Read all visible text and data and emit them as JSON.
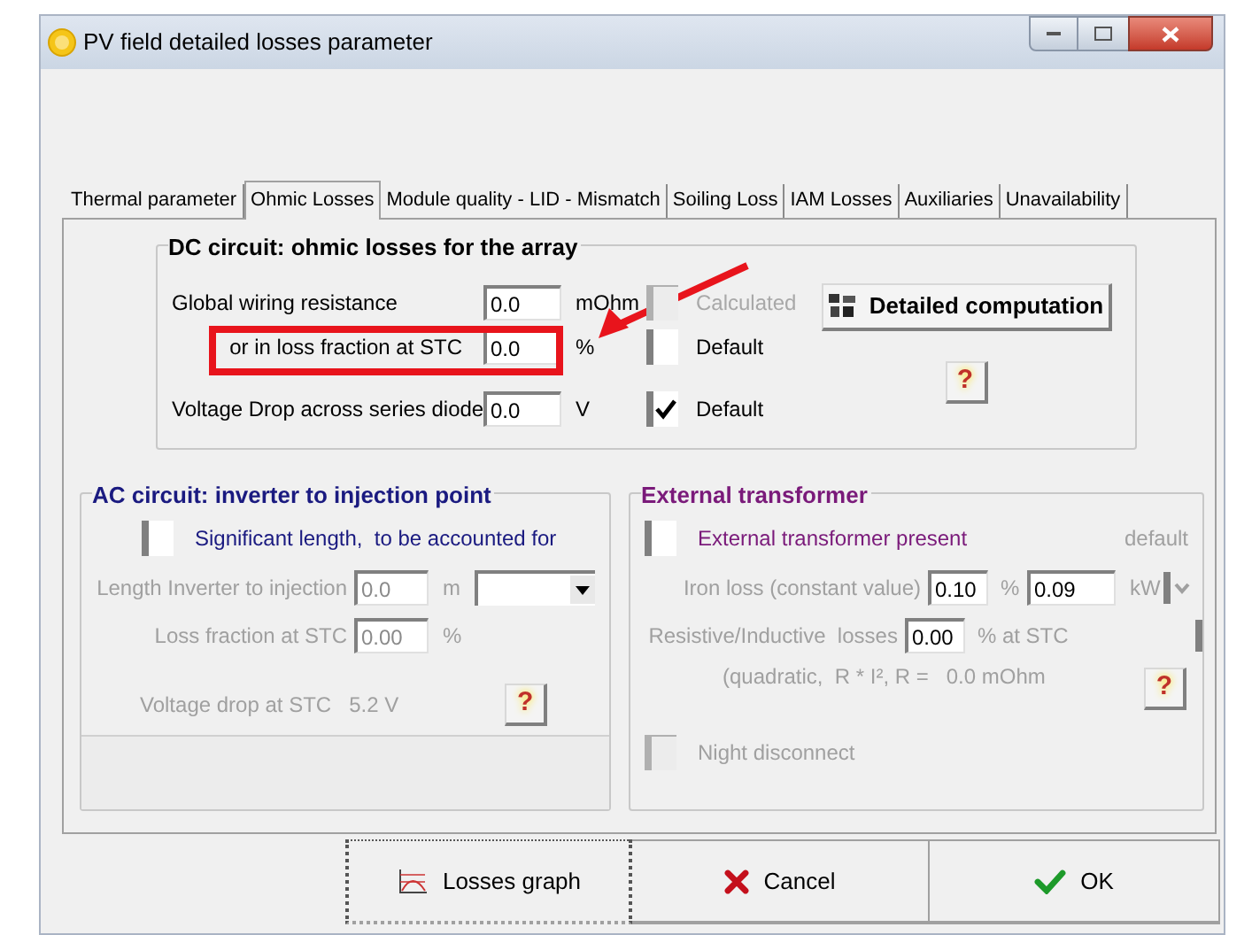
{
  "window": {
    "title": "PV field detailed losses parameter"
  },
  "tabs": [
    {
      "label": "Thermal parameter",
      "selected": false
    },
    {
      "label": "Ohmic Losses",
      "selected": true
    },
    {
      "label": "Module quality - LID - Mismatch",
      "selected": false
    },
    {
      "label": "Soiling Loss",
      "selected": false
    },
    {
      "label": "IAM Losses",
      "selected": false
    },
    {
      "label": "Auxiliaries",
      "selected": false
    },
    {
      "label": "Unavailability",
      "selected": false
    }
  ],
  "dc_circuit": {
    "title": "DC circuit: ohmic losses for the array",
    "rows": [
      {
        "label": "Global wiring resistance",
        "value": "0.0",
        "unit": "mOhm",
        "option": {
          "label": "Calculated",
          "checked": false,
          "disabled": true
        }
      },
      {
        "label": "or in loss fraction at STC",
        "value": "0.0",
        "unit": "%",
        "option": {
          "label": "Default",
          "checked": false,
          "disabled": false
        }
      },
      {
        "label": "Voltage Drop across series diode",
        "value": "0.0",
        "unit": "V",
        "option": {
          "label": "Default",
          "checked": true,
          "disabled": false
        }
      }
    ],
    "detail_button": "Detailed computation",
    "help": "?"
  },
  "ac_circuit": {
    "title": "AC circuit: inverter to injection point",
    "checkbox": {
      "label": "Significant length,  to be accounted for",
      "checked": false
    },
    "length": {
      "label": "Length Inverter to injection",
      "value": "0.0",
      "unit": "m",
      "disabled": true
    },
    "loss_fraction": {
      "label": "Loss fraction at STC",
      "value": "0.00",
      "unit": "%",
      "disabled": true
    },
    "voltage_drop": {
      "label": "Voltage drop at STC",
      "value": "5.2 V"
    },
    "help": "?"
  },
  "transformer": {
    "title": "External transformer",
    "checkbox": {
      "label": "External transformer present",
      "checked": false
    },
    "default_label": "default",
    "iron_loss": {
      "label": "Iron loss (constant value)",
      "value": "0.10",
      "unit": "%",
      "value_2": "0.09",
      "unit_2": "kW"
    },
    "resistive": {
      "label": "Resistive/Inductive  losses",
      "value": "0.00",
      "unit": "% at STC"
    },
    "formula": "(quadratic,  R * I², R =   0.0 mOhm",
    "help": "?",
    "night_disconnect": {
      "label": "Night disconnect",
      "checked": false
    }
  },
  "footer_buttons": [
    {
      "kind": "graph",
      "label": "Losses graph"
    },
    {
      "kind": "cancel",
      "label": "Cancel"
    },
    {
      "kind": "ok",
      "label": "OK"
    }
  ]
}
